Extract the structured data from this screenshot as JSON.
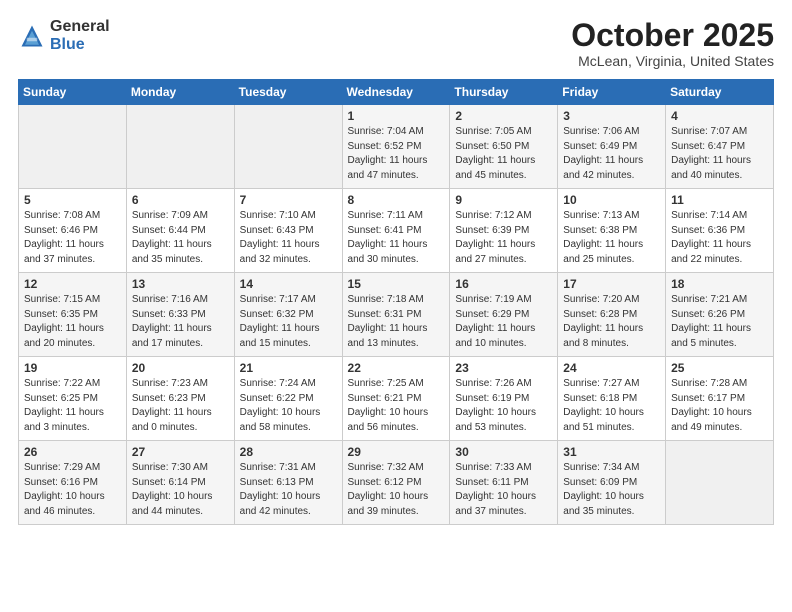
{
  "header": {
    "logo_general": "General",
    "logo_blue": "Blue",
    "month_title": "October 2025",
    "location": "McLean, Virginia, United States"
  },
  "days_of_week": [
    "Sunday",
    "Monday",
    "Tuesday",
    "Wednesday",
    "Thursday",
    "Friday",
    "Saturday"
  ],
  "weeks": [
    [
      {
        "num": "",
        "content": ""
      },
      {
        "num": "",
        "content": ""
      },
      {
        "num": "",
        "content": ""
      },
      {
        "num": "1",
        "content": "Sunrise: 7:04 AM\nSunset: 6:52 PM\nDaylight: 11 hours\nand 47 minutes."
      },
      {
        "num": "2",
        "content": "Sunrise: 7:05 AM\nSunset: 6:50 PM\nDaylight: 11 hours\nand 45 minutes."
      },
      {
        "num": "3",
        "content": "Sunrise: 7:06 AM\nSunset: 6:49 PM\nDaylight: 11 hours\nand 42 minutes."
      },
      {
        "num": "4",
        "content": "Sunrise: 7:07 AM\nSunset: 6:47 PM\nDaylight: 11 hours\nand 40 minutes."
      }
    ],
    [
      {
        "num": "5",
        "content": "Sunrise: 7:08 AM\nSunset: 6:46 PM\nDaylight: 11 hours\nand 37 minutes."
      },
      {
        "num": "6",
        "content": "Sunrise: 7:09 AM\nSunset: 6:44 PM\nDaylight: 11 hours\nand 35 minutes."
      },
      {
        "num": "7",
        "content": "Sunrise: 7:10 AM\nSunset: 6:43 PM\nDaylight: 11 hours\nand 32 minutes."
      },
      {
        "num": "8",
        "content": "Sunrise: 7:11 AM\nSunset: 6:41 PM\nDaylight: 11 hours\nand 30 minutes."
      },
      {
        "num": "9",
        "content": "Sunrise: 7:12 AM\nSunset: 6:39 PM\nDaylight: 11 hours\nand 27 minutes."
      },
      {
        "num": "10",
        "content": "Sunrise: 7:13 AM\nSunset: 6:38 PM\nDaylight: 11 hours\nand 25 minutes."
      },
      {
        "num": "11",
        "content": "Sunrise: 7:14 AM\nSunset: 6:36 PM\nDaylight: 11 hours\nand 22 minutes."
      }
    ],
    [
      {
        "num": "12",
        "content": "Sunrise: 7:15 AM\nSunset: 6:35 PM\nDaylight: 11 hours\nand 20 minutes."
      },
      {
        "num": "13",
        "content": "Sunrise: 7:16 AM\nSunset: 6:33 PM\nDaylight: 11 hours\nand 17 minutes."
      },
      {
        "num": "14",
        "content": "Sunrise: 7:17 AM\nSunset: 6:32 PM\nDaylight: 11 hours\nand 15 minutes."
      },
      {
        "num": "15",
        "content": "Sunrise: 7:18 AM\nSunset: 6:31 PM\nDaylight: 11 hours\nand 13 minutes."
      },
      {
        "num": "16",
        "content": "Sunrise: 7:19 AM\nSunset: 6:29 PM\nDaylight: 11 hours\nand 10 minutes."
      },
      {
        "num": "17",
        "content": "Sunrise: 7:20 AM\nSunset: 6:28 PM\nDaylight: 11 hours\nand 8 minutes."
      },
      {
        "num": "18",
        "content": "Sunrise: 7:21 AM\nSunset: 6:26 PM\nDaylight: 11 hours\nand 5 minutes."
      }
    ],
    [
      {
        "num": "19",
        "content": "Sunrise: 7:22 AM\nSunset: 6:25 PM\nDaylight: 11 hours\nand 3 minutes."
      },
      {
        "num": "20",
        "content": "Sunrise: 7:23 AM\nSunset: 6:23 PM\nDaylight: 11 hours\nand 0 minutes."
      },
      {
        "num": "21",
        "content": "Sunrise: 7:24 AM\nSunset: 6:22 PM\nDaylight: 10 hours\nand 58 minutes."
      },
      {
        "num": "22",
        "content": "Sunrise: 7:25 AM\nSunset: 6:21 PM\nDaylight: 10 hours\nand 56 minutes."
      },
      {
        "num": "23",
        "content": "Sunrise: 7:26 AM\nSunset: 6:19 PM\nDaylight: 10 hours\nand 53 minutes."
      },
      {
        "num": "24",
        "content": "Sunrise: 7:27 AM\nSunset: 6:18 PM\nDaylight: 10 hours\nand 51 minutes."
      },
      {
        "num": "25",
        "content": "Sunrise: 7:28 AM\nSunset: 6:17 PM\nDaylight: 10 hours\nand 49 minutes."
      }
    ],
    [
      {
        "num": "26",
        "content": "Sunrise: 7:29 AM\nSunset: 6:16 PM\nDaylight: 10 hours\nand 46 minutes."
      },
      {
        "num": "27",
        "content": "Sunrise: 7:30 AM\nSunset: 6:14 PM\nDaylight: 10 hours\nand 44 minutes."
      },
      {
        "num": "28",
        "content": "Sunrise: 7:31 AM\nSunset: 6:13 PM\nDaylight: 10 hours\nand 42 minutes."
      },
      {
        "num": "29",
        "content": "Sunrise: 7:32 AM\nSunset: 6:12 PM\nDaylight: 10 hours\nand 39 minutes."
      },
      {
        "num": "30",
        "content": "Sunrise: 7:33 AM\nSunset: 6:11 PM\nDaylight: 10 hours\nand 37 minutes."
      },
      {
        "num": "31",
        "content": "Sunrise: 7:34 AM\nSunset: 6:09 PM\nDaylight: 10 hours\nand 35 minutes."
      },
      {
        "num": "",
        "content": ""
      }
    ]
  ]
}
